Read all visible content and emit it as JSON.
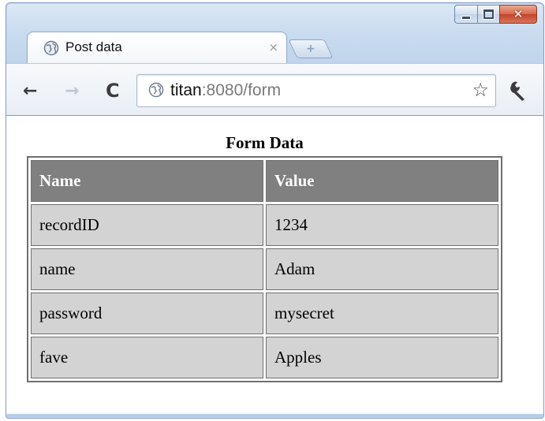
{
  "window": {
    "caption_buttons": {
      "minimize": "minimize",
      "maximize": "maximize",
      "close": "✕"
    }
  },
  "tab": {
    "title": "Post data",
    "close_glyph": "×",
    "favicon": "globe-icon"
  },
  "new_tab": {
    "glyph": "+"
  },
  "toolbar": {
    "back_glyph": "←",
    "forward_glyph": "→",
    "reload_glyph": "C",
    "address": {
      "host": "titan",
      "rest": ":8080/form"
    },
    "star_glyph": "☆",
    "wrench": "wrench-icon"
  },
  "page": {
    "caption": "Form Data",
    "headers": [
      "Name",
      "Value"
    ],
    "rows": [
      [
        "recordID",
        "1234"
      ],
      [
        "name",
        "Adam"
      ],
      [
        "password",
        "mysecret"
      ],
      [
        "fave",
        "Apples"
      ]
    ]
  },
  "colors": {
    "header_bg": "#808080",
    "cell_bg": "#d3d3d3",
    "close_button": "#c4432a"
  }
}
